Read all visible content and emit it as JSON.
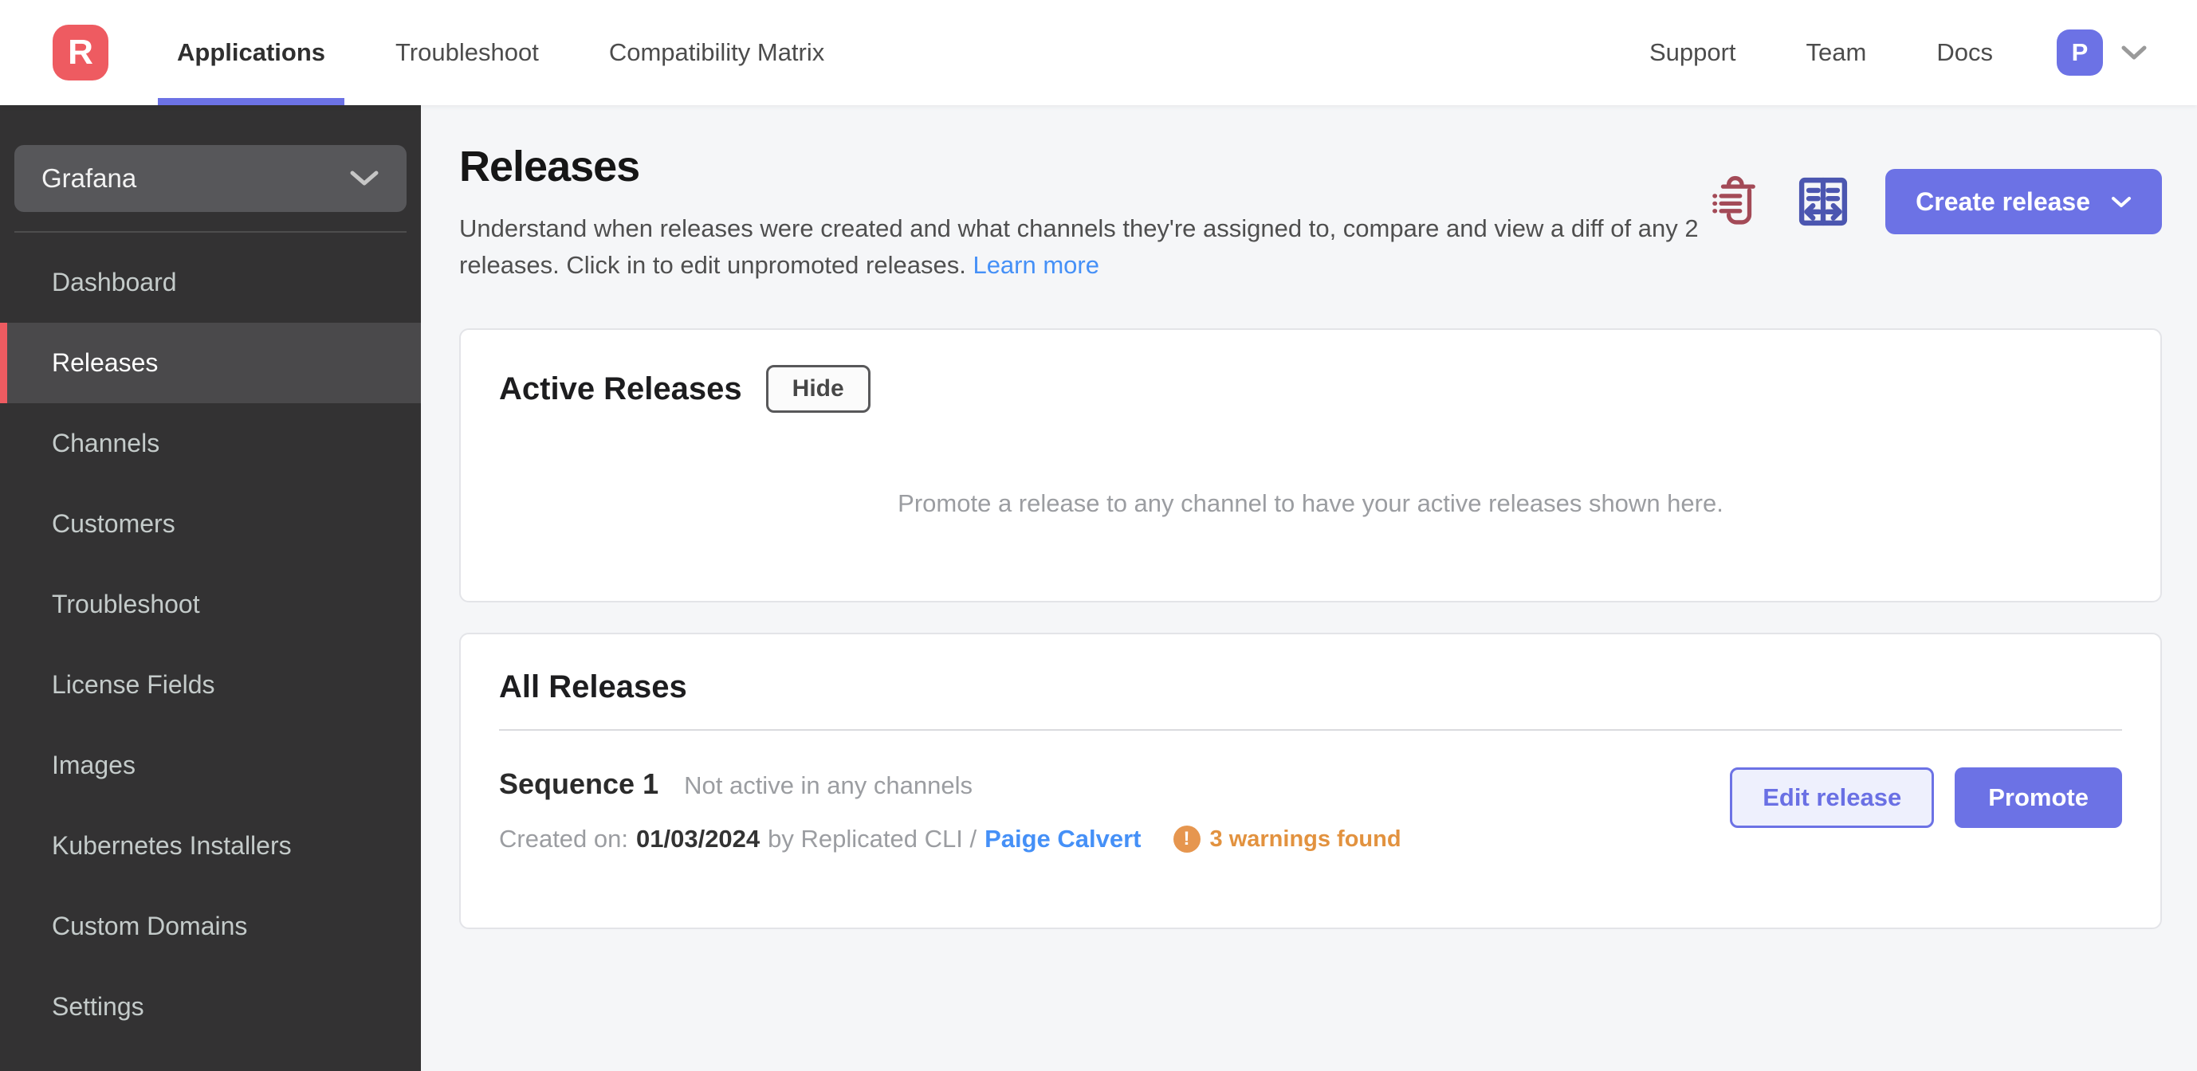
{
  "colors": {
    "accent": "#6c72e5",
    "brand_red": "#ee5b61",
    "link_blue": "#4590f7",
    "warning": "#e2923f",
    "trash_icon": "#a34a57",
    "diff_icon": "#4b56b0",
    "sidebar_bg": "#333233",
    "main_bg": "#f5f6f8"
  },
  "header": {
    "logo_letter": "R",
    "nav": [
      {
        "label": "Applications",
        "active": true
      },
      {
        "label": "Troubleshoot",
        "active": false
      },
      {
        "label": "Compatibility Matrix",
        "active": false
      }
    ],
    "right_nav": [
      {
        "label": "Support"
      },
      {
        "label": "Team"
      },
      {
        "label": "Docs"
      }
    ],
    "avatar_initial": "P"
  },
  "sidebar": {
    "app_selector": "Grafana",
    "items": [
      {
        "label": "Dashboard",
        "active": false
      },
      {
        "label": "Releases",
        "active": true
      },
      {
        "label": "Channels",
        "active": false
      },
      {
        "label": "Customers",
        "active": false
      },
      {
        "label": "Troubleshoot",
        "active": false
      },
      {
        "label": "License Fields",
        "active": false
      },
      {
        "label": "Images",
        "active": false
      },
      {
        "label": "Kubernetes Installers",
        "active": false
      },
      {
        "label": "Custom Domains",
        "active": false
      },
      {
        "label": "Settings",
        "active": false
      }
    ]
  },
  "main": {
    "title": "Releases",
    "description": "Understand when releases were created and what channels they're assigned to, compare and view a diff of any 2 releases. Click in to edit unpromoted releases.",
    "learn_more": "Learn more",
    "create_release_label": "Create release",
    "active_releases": {
      "title": "Active Releases",
      "hide_button": "Hide",
      "empty_text": "Promote a release to any channel to have your active releases shown here."
    },
    "all_releases": {
      "title": "All Releases",
      "release": {
        "sequence": "Sequence 1",
        "status": "Not active in any channels",
        "created_prefix": "Created on:",
        "created_date": "01/03/2024",
        "created_by": "by Replicated CLI /",
        "author": "Paige Calvert",
        "warning_symbol": "!",
        "warnings_text": "3 warnings found",
        "edit_button": "Edit release",
        "promote_button": "Promote"
      }
    }
  }
}
